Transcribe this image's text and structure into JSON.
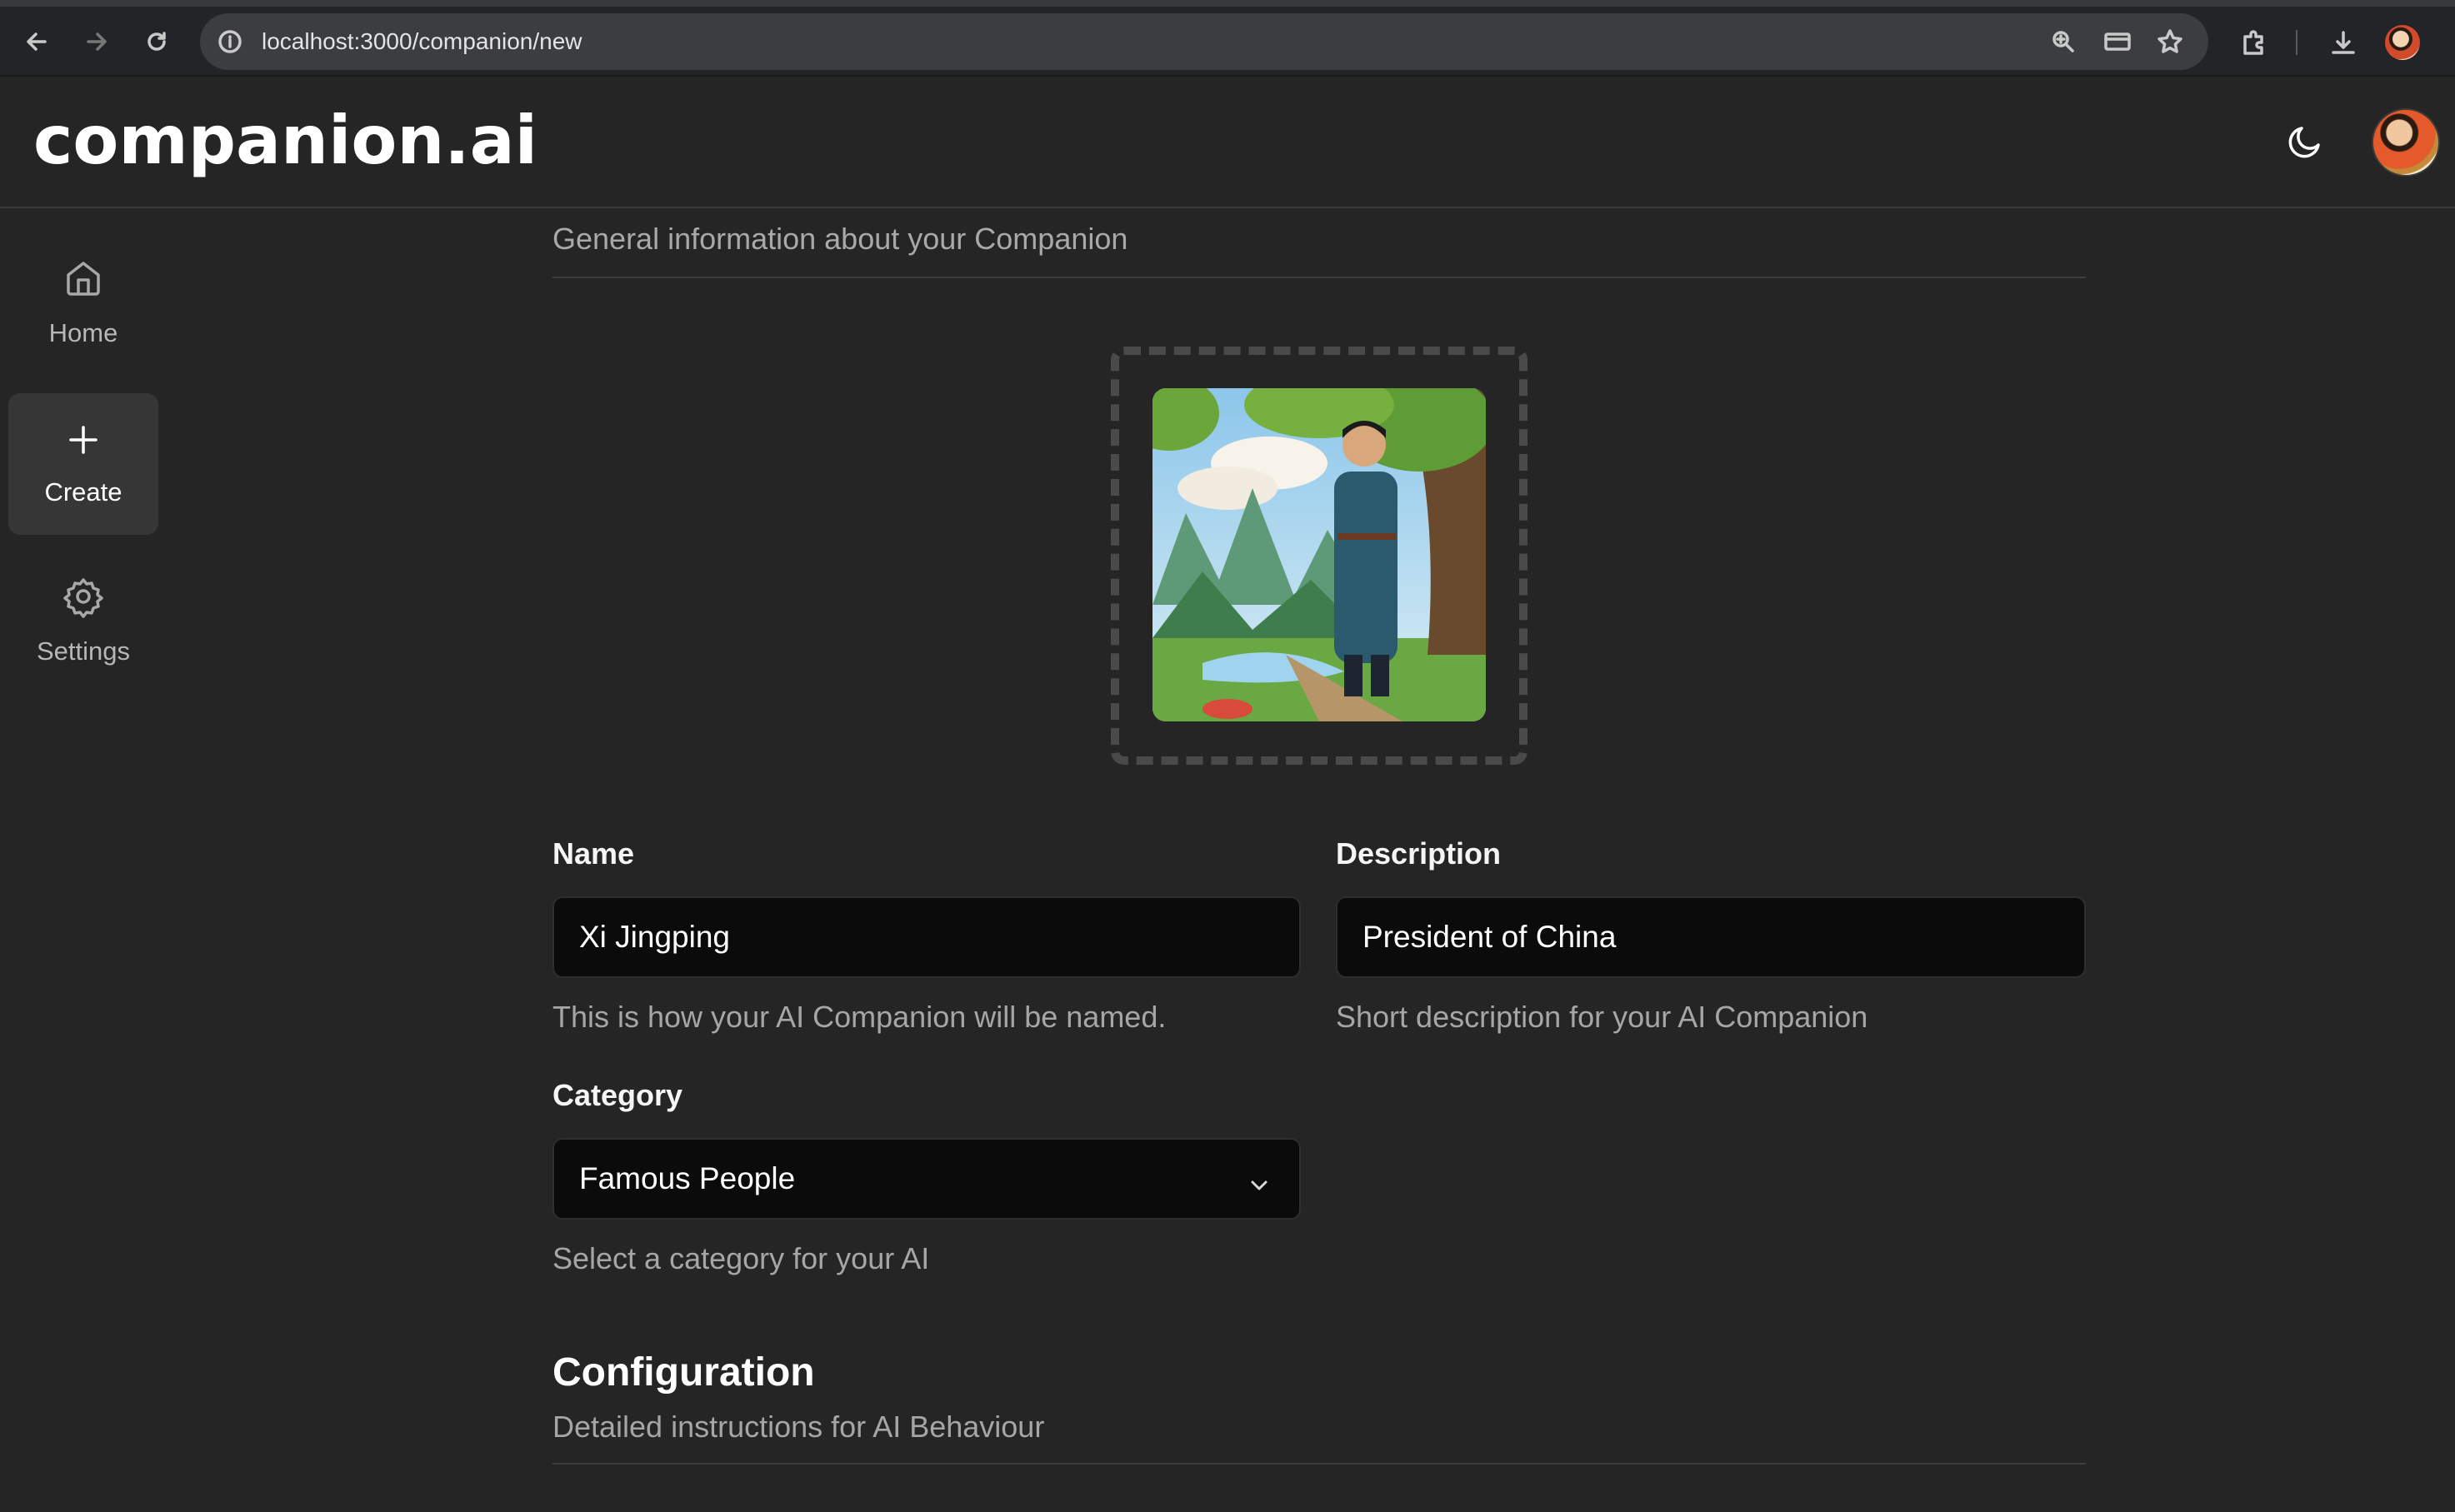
{
  "browser": {
    "url": "localhost:3000/companion/new"
  },
  "app": {
    "logo": "companion.ai"
  },
  "sidebar": {
    "items": [
      {
        "label": "Home",
        "icon": "home-icon"
      },
      {
        "label": "Create",
        "icon": "plus-icon"
      },
      {
        "label": "Settings",
        "icon": "gear-icon"
      }
    ]
  },
  "form": {
    "general_subtitle": "General information about your Companion",
    "name": {
      "label": "Name",
      "value": "Xi Jingping",
      "help": "This is how your AI Companion will be named."
    },
    "description": {
      "label": "Description",
      "value": "President of China",
      "help": "Short description for your AI Companion"
    },
    "category": {
      "label": "Category",
      "value": "Famous People",
      "help": "Select a category for your AI"
    },
    "configuration": {
      "title": "Configuration",
      "subtitle": "Detailed instructions for AI Behaviour"
    }
  },
  "colors": {
    "background": "#252525",
    "input_bg": "#0b0b0b",
    "active_nav": "#363636"
  }
}
